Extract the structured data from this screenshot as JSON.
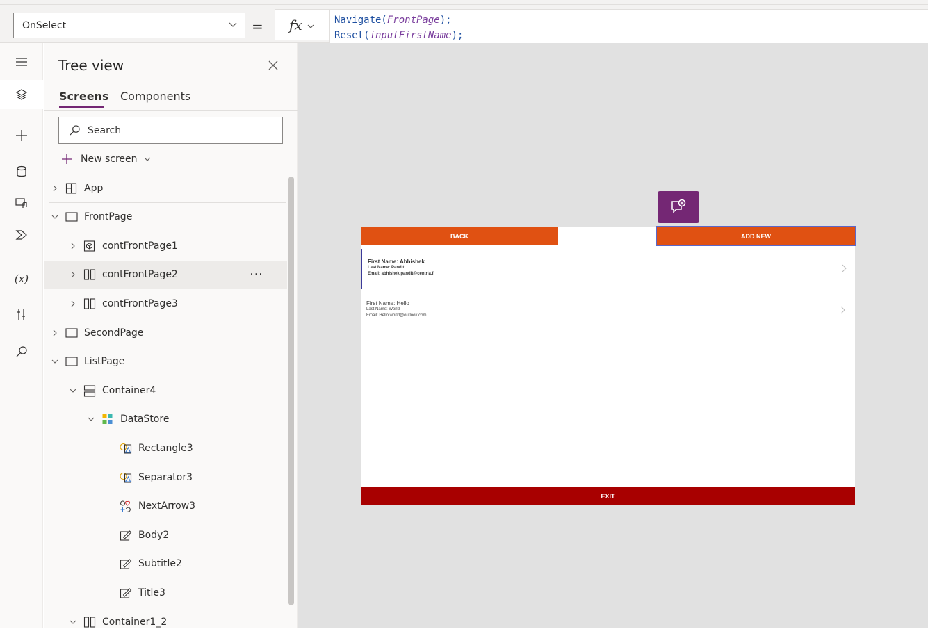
{
  "formula_bar": {
    "property": "OnSelect",
    "equals": "=",
    "fx_label": "fx",
    "formula_line1_func": "Navigate(",
    "formula_line1_arg": "FrontPage",
    "formula_line1_end": ");",
    "formula_line2_func": "Reset(",
    "formula_line2_arg": "inputFirstName",
    "formula_line2_end": ");"
  },
  "rail": {
    "items": [
      {
        "icon": "hamburger-icon"
      },
      {
        "icon": "layers-icon",
        "active": true
      },
      {
        "icon": "plus-icon"
      },
      {
        "icon": "data-icon"
      },
      {
        "icon": "media-icon"
      },
      {
        "icon": "power-automate-icon"
      },
      {
        "icon": "variables-icon",
        "text": "(x)"
      },
      {
        "icon": "tools-icon"
      },
      {
        "icon": "search-icon"
      }
    ]
  },
  "tree": {
    "title": "Tree view",
    "tabs": [
      "Screens",
      "Components"
    ],
    "search_placeholder": "Search",
    "new_screen": "New screen",
    "rows": [
      {
        "label": "App",
        "indent": 0,
        "expander": "collapsed",
        "icon": "app-icon"
      },
      {
        "label": "FrontPage",
        "indent": 0,
        "expander": "expanded",
        "icon": "screen-icon"
      },
      {
        "label": "contFrontPage1",
        "indent": 1,
        "expander": "collapsed",
        "icon": "component-icon"
      },
      {
        "label": "contFrontPage2",
        "indent": 1,
        "expander": "collapsed",
        "icon": "horizontal-container-icon",
        "hover": true
      },
      {
        "label": "contFrontPage3",
        "indent": 1,
        "expander": "collapsed",
        "icon": "horizontal-container-icon"
      },
      {
        "label": "SecondPage",
        "indent": 0,
        "expander": "collapsed",
        "icon": "screen-icon"
      },
      {
        "label": "ListPage",
        "indent": 0,
        "expander": "expanded",
        "icon": "screen-icon"
      },
      {
        "label": "Container4",
        "indent": 1,
        "expander": "expanded",
        "icon": "vertical-container-icon"
      },
      {
        "label": "DataStore",
        "indent": 2,
        "expander": "expanded",
        "icon": "gallery-icon"
      },
      {
        "label": "Rectangle3",
        "indent": 3,
        "expander": "none",
        "icon": "shape-icon"
      },
      {
        "label": "Separator3",
        "indent": 3,
        "expander": "none",
        "icon": "shape-icon"
      },
      {
        "label": "NextArrow3",
        "indent": 3,
        "expander": "none",
        "icon": "icons-icon"
      },
      {
        "label": "Body2",
        "indent": 3,
        "expander": "none",
        "icon": "label-icon"
      },
      {
        "label": "Subtitle2",
        "indent": 3,
        "expander": "none",
        "icon": "label-icon"
      },
      {
        "label": "Title3",
        "indent": 3,
        "expander": "none",
        "icon": "label-icon"
      },
      {
        "label": "Container1_2",
        "indent": 1,
        "expander": "expanded",
        "icon": "horizontal-container-icon"
      }
    ],
    "more": "···"
  },
  "app": {
    "back_label": "BACK",
    "add_label": "ADD NEW",
    "exit_label": "EXIT",
    "items": [
      {
        "first": "First Name: Abhishek",
        "last": "Last Name: Pandit",
        "email": "Email: abhishek.pandit@centria.fi",
        "selected": true
      },
      {
        "first": "First Name: Hello",
        "last": "Last Name: World",
        "email": "Email: Hello.world@outlook.com",
        "selected": false
      }
    ]
  },
  "colors": {
    "accent_purple": "#742774",
    "button_orange": "#e05112",
    "exit_red": "#a80000"
  }
}
